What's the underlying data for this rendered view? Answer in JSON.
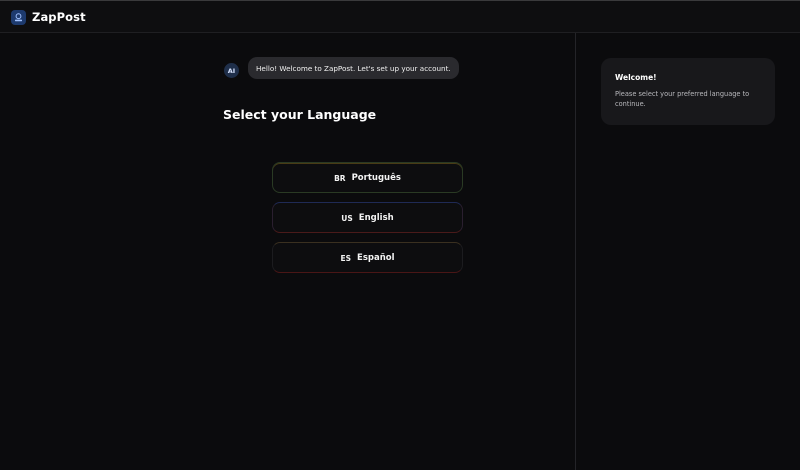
{
  "app": {
    "name": "ZapPost"
  },
  "chat": {
    "avatar_label": "AI",
    "message": "Hello! Welcome to ZapPost. Let's set up your account."
  },
  "main": {
    "heading": "Select your Language"
  },
  "languages": [
    {
      "code": "BR",
      "label": "Português"
    },
    {
      "code": "US",
      "label": "English"
    },
    {
      "code": "ES",
      "label": "Español"
    }
  ],
  "sidebar": {
    "title": "Welcome!",
    "body": "Please select your preferred language to continue."
  },
  "colors": {
    "background": "#0b0b0d",
    "card": "#18181b",
    "bubble": "#2a2a2e"
  }
}
